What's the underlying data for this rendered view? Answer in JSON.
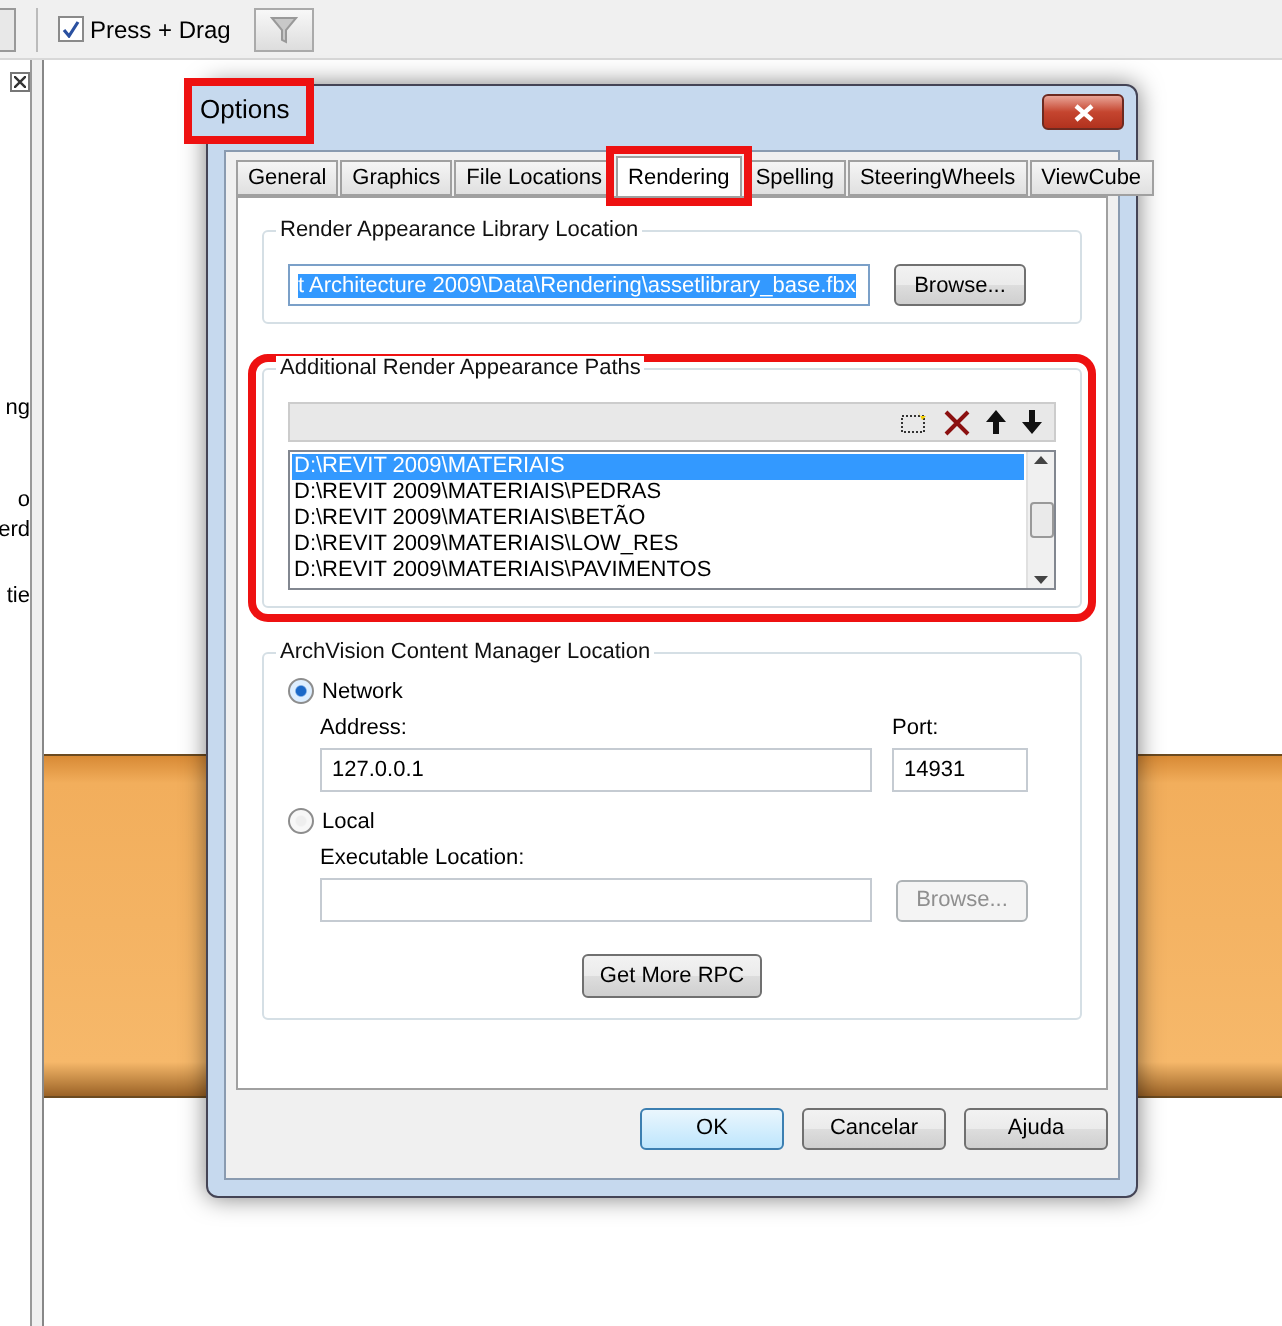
{
  "toolbar": {
    "checkbox": {
      "label": "Press + Drag",
      "checked": true
    }
  },
  "side_panel": {
    "texts": [
      "ng",
      "o",
      "erd",
      "tie"
    ]
  },
  "dialog": {
    "title": "Options",
    "title_highlighted": true,
    "tabs": [
      {
        "label": "General",
        "selected": false,
        "highlighted": false
      },
      {
        "label": "Graphics",
        "selected": false,
        "highlighted": false
      },
      {
        "label": "File Locations",
        "selected": false,
        "highlighted": false
      },
      {
        "label": "Rendering",
        "selected": true,
        "highlighted": true
      },
      {
        "label": "Spelling",
        "selected": false,
        "highlighted": false
      },
      {
        "label": "SteeringWheels",
        "selected": false,
        "highlighted": false
      },
      {
        "label": "ViewCube",
        "selected": false,
        "highlighted": false
      }
    ],
    "library_group": {
      "legend": "Render Appearance Library Location",
      "path": "t Architecture 2009\\Data\\Rendering\\assetlibrary_base.fbx",
      "browse": "Browse..."
    },
    "paths_group": {
      "legend": "Additional Render Appearance Paths",
      "highlighted": true,
      "items": [
        {
          "label": "D:\\REVIT 2009\\MATERIAIS",
          "selected": true
        },
        {
          "label": "D:\\REVIT 2009\\MATERIAIS\\PEDRAS",
          "selected": false
        },
        {
          "label": "D:\\REVIT 2009\\MATERIAIS\\BETÃO",
          "selected": false
        },
        {
          "label": "D:\\REVIT 2009\\MATERIAIS\\LOW_RES",
          "selected": false
        },
        {
          "label": "D:\\REVIT 2009\\MATERIAIS\\PAVIMENTOS",
          "selected": false
        }
      ]
    },
    "archvision_group": {
      "legend": "ArchVision Content Manager Location",
      "network": {
        "label": "Network",
        "selected": true,
        "address_label": "Address:",
        "address": "127.0.0.1",
        "port_label": "Port:",
        "port": "14931"
      },
      "local": {
        "label": "Local",
        "selected": false,
        "location_label": "Executable Location:",
        "browse": "Browse...",
        "browse_disabled": true
      },
      "get_more": "Get More RPC"
    },
    "buttons": [
      {
        "label": "OK",
        "default": true
      },
      {
        "label": "Cancelar",
        "default": false
      },
      {
        "label": "Ajuda",
        "default": false
      }
    ]
  }
}
